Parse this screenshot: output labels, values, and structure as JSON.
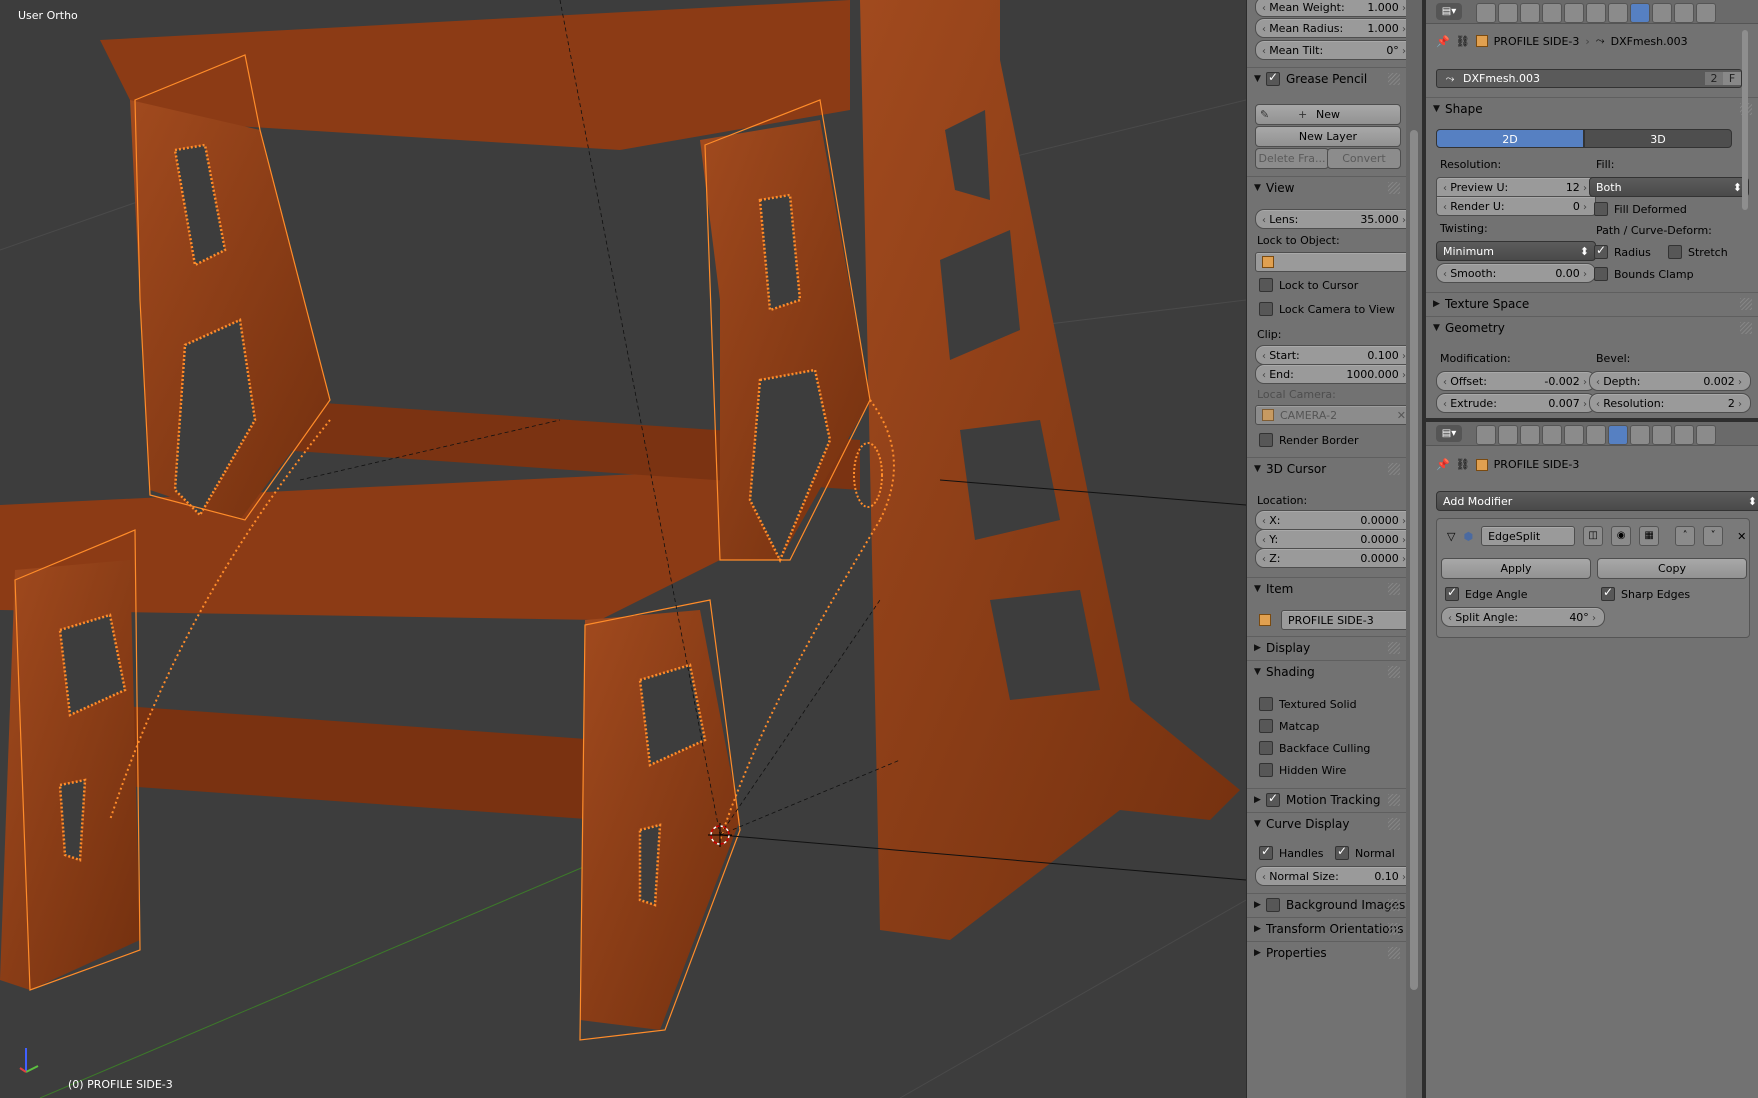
{
  "viewport": {
    "view_label": "User Ortho",
    "object_label": "(0) PROFILE SIDE-3"
  },
  "npanel": {
    "top_fields": [
      {
        "label": "Mean Weight:",
        "value": "1.000"
      },
      {
        "label": "Mean Radius:",
        "value": "1.000"
      },
      {
        "label": "Mean Tilt:",
        "value": "0°"
      }
    ],
    "grease_pencil": {
      "title": "Grease Pencil",
      "new_label": "New",
      "new_layer_label": "New Layer",
      "delete_frame_label": "Delete Fra...",
      "convert_label": "Convert"
    },
    "view": {
      "title": "View",
      "lens_label": "Lens:",
      "lens_value": "35.000",
      "lock_to_object_label": "Lock to Object:",
      "lock_to_cursor_label": "Lock to Cursor",
      "lock_camera_label": "Lock Camera to View",
      "clip_label": "Clip:",
      "start_label": "Start:",
      "start_value": "0.100",
      "end_label": "End:",
      "end_value": "1000.000",
      "local_camera_label": "Local Camera:",
      "camera_value": "CAMERA-2",
      "render_border_label": "Render Border"
    },
    "cursor": {
      "title": "3D Cursor",
      "location_label": "Location:",
      "x_label": "X:",
      "x_value": "0.0000",
      "y_label": "Y:",
      "y_value": "0.0000",
      "z_label": "Z:",
      "z_value": "0.0000"
    },
    "item": {
      "title": "Item",
      "name": "PROFILE SIDE-3"
    },
    "display_title": "Display",
    "shading": {
      "title": "Shading",
      "textured_solid": "Textured Solid",
      "matcap": "Matcap",
      "backface_culling": "Backface Culling",
      "hidden_wire": "Hidden Wire"
    },
    "motion_tracking_title": "Motion Tracking",
    "curve_display": {
      "title": "Curve Display",
      "handles_label": "Handles",
      "normal_label": "Normal",
      "normal_size_label": "Normal Size:",
      "normal_size_value": "0.10"
    },
    "background_images_title": "Background Images",
    "transform_orientations_title": "Transform Orientations",
    "properties_title": "Properties"
  },
  "props_top": {
    "breadcrumb_object": "PROFILE SIDE-3",
    "breadcrumb_data": "DXFmesh.003",
    "datablock_name": "DXFmesh.003",
    "datablock_users": "2",
    "datablock_fake": "F",
    "shape": {
      "title": "Shape",
      "tab_2d": "2D",
      "tab_3d": "3D",
      "resolution_label": "Resolution:",
      "preview_u_label": "Preview U:",
      "preview_u_value": "12",
      "render_u_label": "Render U:",
      "render_u_value": "0",
      "fill_label": "Fill:",
      "fill_value": "Both",
      "fill_deformed_label": "Fill Deformed",
      "twisting_label": "Twisting:",
      "twisting_value": "Minimum",
      "path_label": "Path / Curve-Deform:",
      "radius_label": "Radius",
      "stretch_label": "Stretch",
      "smooth_label": "Smooth:",
      "smooth_value": "0.00",
      "bounds_clamp_label": "Bounds Clamp"
    },
    "texture_space_title": "Texture Space",
    "geometry": {
      "title": "Geometry",
      "modification_label": "Modification:",
      "bevel_label": "Bevel:",
      "offset_label": "Offset:",
      "offset_value": "-0.002",
      "depth_label": "Depth:",
      "depth_value": "0.002",
      "extrude_label": "Extrude:",
      "extrude_value": "0.007",
      "resolution_label": "Resolution:",
      "resolution_value": "2"
    }
  },
  "props_bottom": {
    "breadcrumb_object": "PROFILE SIDE-3",
    "add_modifier_label": "Add Modifier",
    "modifier": {
      "name": "EdgeSplit",
      "apply_label": "Apply",
      "copy_label": "Copy",
      "edge_angle_label": "Edge Angle",
      "sharp_edges_label": "Sharp Edges",
      "split_angle_label": "Split Angle:",
      "split_angle_value": "40°"
    }
  },
  "colors": {
    "viewport_bg": "#3d3d3d",
    "wood": "#8a3a16",
    "selection_orange": "#ff8c2a",
    "tab_active": "#5680c2",
    "panel_bg": "#727272"
  }
}
